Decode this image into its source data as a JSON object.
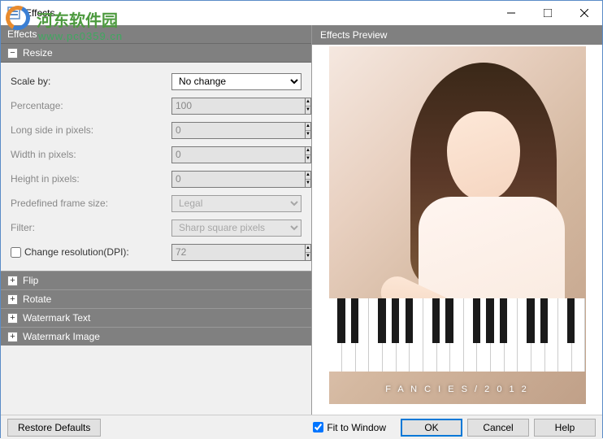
{
  "window": {
    "title": "Effects"
  },
  "watermark": {
    "name": "河东软件园",
    "url": "www.pc0359.cn"
  },
  "panel": {
    "effects_header": "Effects",
    "resize_header": "Resize",
    "sections": {
      "flip": "Flip",
      "rotate": "Rotate",
      "watermark_text": "Watermark Text",
      "watermark_image": "Watermark Image"
    }
  },
  "form": {
    "scale_by": {
      "label": "Scale by:",
      "value": "No change"
    },
    "percentage": {
      "label": "Percentage:",
      "value": "100"
    },
    "long_side": {
      "label": "Long side in pixels:",
      "value": "0"
    },
    "width": {
      "label": "Width in pixels:",
      "value": "0"
    },
    "height": {
      "label": "Height in pixels:",
      "value": "0"
    },
    "predefined": {
      "label": "Predefined frame size:",
      "value": "Legal"
    },
    "filter": {
      "label": "Filter:",
      "value": "Sharp square pixels"
    },
    "resolution": {
      "label": "Change resolution(DPI):",
      "value": "72"
    }
  },
  "preview": {
    "header": "Effects Preview",
    "caption": "F A N C I E S / 2 0 1 2",
    "fit_label": "Fit to Window",
    "fit_checked": true
  },
  "buttons": {
    "restore": "Restore Defaults",
    "ok": "OK",
    "cancel": "Cancel",
    "help": "Help"
  }
}
